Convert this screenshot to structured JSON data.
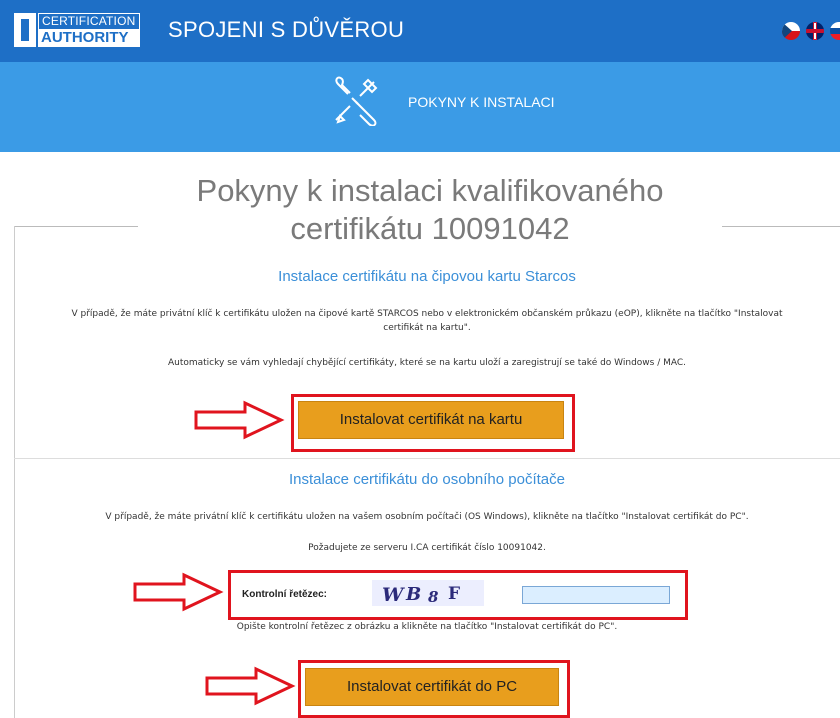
{
  "header": {
    "logo_line1": "CERTIFICATION",
    "logo_line2": "AUTHORITY",
    "title": "SPOJENI S DŮVĚROU",
    "languages": [
      "cz-flag",
      "uk-flag",
      "sk-flag"
    ]
  },
  "banner": {
    "icon": "tools-icon",
    "label": "POKYNY K INSTALACI"
  },
  "page": {
    "title_line1": "Pokyny k instalaci kvalifikovaného",
    "title_line2": "certifikátu 10091042"
  },
  "card_section": {
    "title": "Instalace certifikátu na čipovou kartu Starcos",
    "text1_line1": "V případě, že máte privátní klíč k certifikátu uložen na čipové kartě STARCOS nebo v elektronickém občanském průkazu (eOP), klikněte na tlačítko \"Instalovat",
    "text1_line2": "certifikát na kartu\".",
    "text2": "Automaticky se vám vyhledají chybějící certifikáty, které se na kartu uloží a zaregistrují se také do Windows / MAC.",
    "button_label": "Instalovat certifikát na kartu"
  },
  "pc_section": {
    "title": "Instalace certifikátu do osobního počítače",
    "text1": "V případě, že máte privátní klíč k certifikátu uložen na vašem osobním počítači (OS Windows), klikněte na tlačítko \"Instalovat certifikát do PC\".",
    "text2": "Požadujete ze serveru I.CA certifikát číslo 10091042.",
    "captcha_label": "Kontrolní řetězec:",
    "captcha_value": "",
    "captcha_hint": "Opište kontrolní řetězec z obrázku a klikněte na tlačítko \"Instalovat certifikát do PC\".",
    "button_label": "Instalovat certifikát do PC"
  },
  "colors": {
    "topbar": "#1e6fc6",
    "banner": "#3b9be6",
    "button": "#e89e1d",
    "highlight": "#e0141e",
    "section_title": "#3b8fd8"
  }
}
